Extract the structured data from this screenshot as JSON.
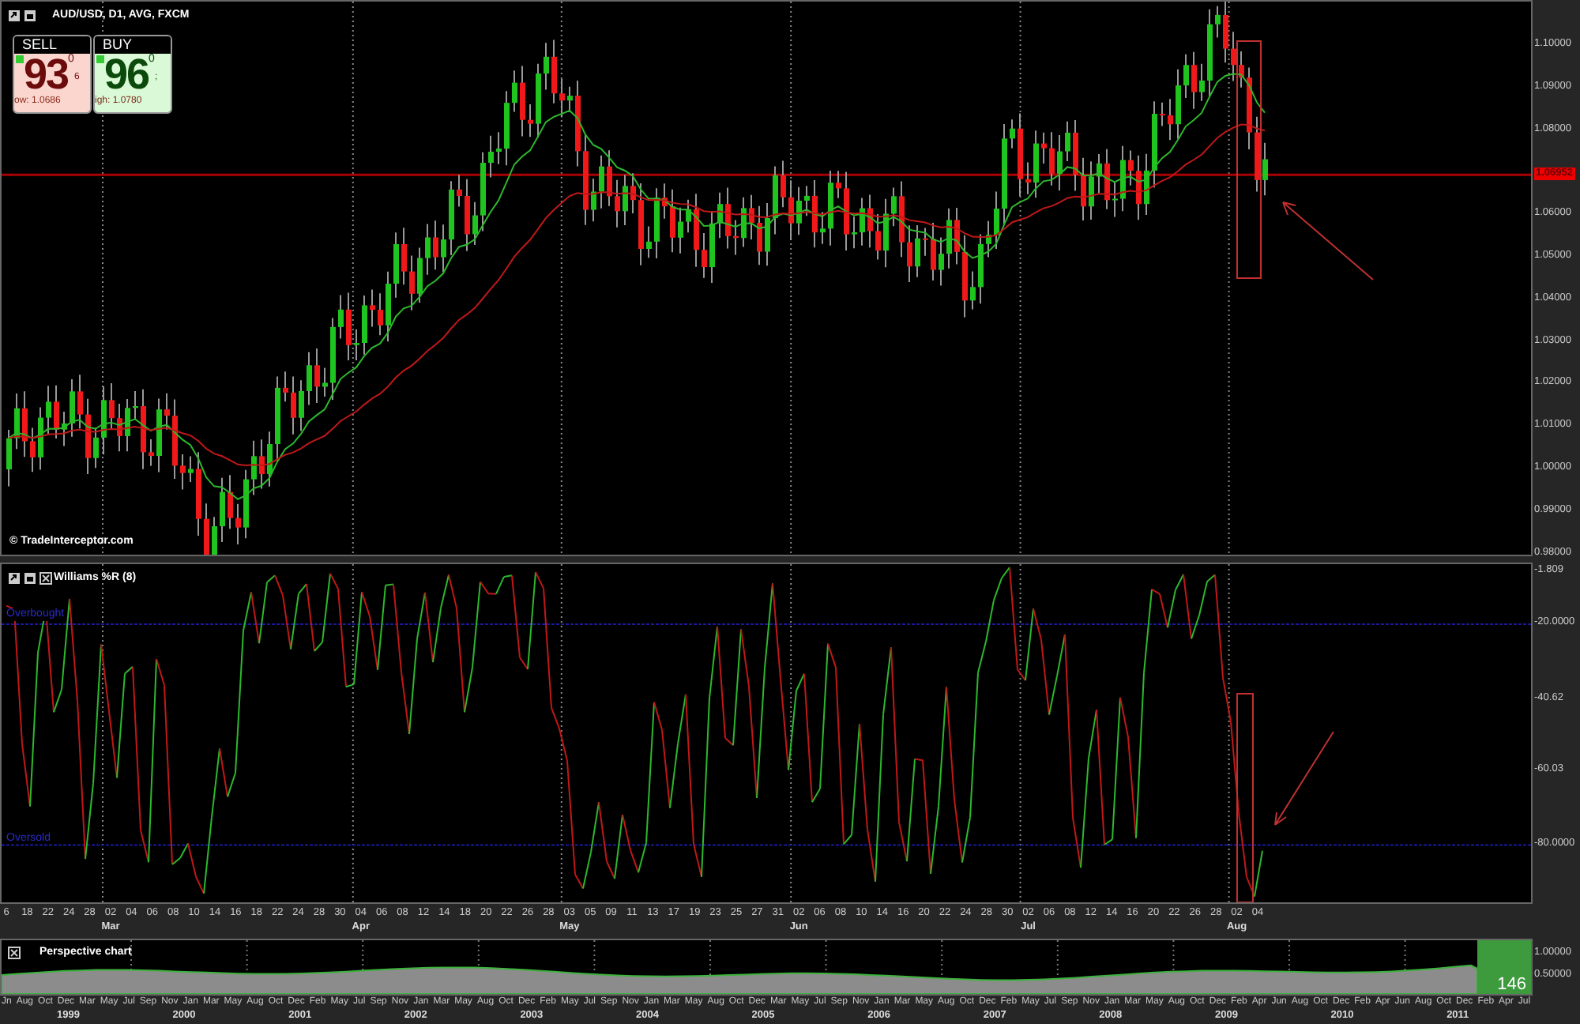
{
  "main_chart": {
    "title": "AUD/USD, D1, AVG, FXCM",
    "quotes": [
      {
        "kind": "sell",
        "label": "SELL",
        "big": "93",
        "pip": "0",
        "tail": "6",
        "range": "ow: 1.0686"
      },
      {
        "kind": "buy",
        "label": "BUY",
        "big": "96",
        "pip": "0",
        "tail": ";",
        "range": "igh: 1.0780"
      }
    ],
    "price_ticks": [
      "1.10000",
      "1.09000",
      "1.08000",
      "1.06000",
      "1.05000",
      "1.04000",
      "1.03000",
      "1.02000",
      "1.01000",
      "1.00000",
      "0.99000",
      "0.98000"
    ],
    "current_price": "1.06952",
    "watermark": "© TradeInterceptor.com"
  },
  "indicator": {
    "title": "Williams %R (8)",
    "overbought_label": "Overbought",
    "oversold_label": "Oversold",
    "ticks": [
      "-1.809",
      "-20.0000",
      "-40.62",
      "-60.03",
      "-80.0000"
    ]
  },
  "date_axis": [
    {
      "label": "6"
    },
    {
      "label": "18"
    },
    {
      "label": "22"
    },
    {
      "label": "24"
    },
    {
      "label": "28"
    },
    {
      "label": "02",
      "month": "Mar"
    },
    {
      "label": "04"
    },
    {
      "label": "06"
    },
    {
      "label": "08"
    },
    {
      "label": "10"
    },
    {
      "label": "14"
    },
    {
      "label": "16"
    },
    {
      "label": "18"
    },
    {
      "label": "22"
    },
    {
      "label": "24"
    },
    {
      "label": "28"
    },
    {
      "label": "30"
    },
    {
      "label": "04",
      "month": "Apr"
    },
    {
      "label": "06"
    },
    {
      "label": "08"
    },
    {
      "label": "12"
    },
    {
      "label": "14"
    },
    {
      "label": "18"
    },
    {
      "label": "20"
    },
    {
      "label": "22"
    },
    {
      "label": "26"
    },
    {
      "label": "28"
    },
    {
      "label": "03",
      "month": "May"
    },
    {
      "label": "05"
    },
    {
      "label": "09"
    },
    {
      "label": "11"
    },
    {
      "label": "13"
    },
    {
      "label": "17"
    },
    {
      "label": "19"
    },
    {
      "label": "23"
    },
    {
      "label": "25"
    },
    {
      "label": "27"
    },
    {
      "label": "31"
    },
    {
      "label": "02",
      "month": "Jun"
    },
    {
      "label": "06"
    },
    {
      "label": "08"
    },
    {
      "label": "10"
    },
    {
      "label": "14"
    },
    {
      "label": "16"
    },
    {
      "label": "20"
    },
    {
      "label": "22"
    },
    {
      "label": "24"
    },
    {
      "label": "28"
    },
    {
      "label": "30"
    },
    {
      "label": "02",
      "month": "Jul"
    },
    {
      "label": "06"
    },
    {
      "label": "08"
    },
    {
      "label": "12"
    },
    {
      "label": "14"
    },
    {
      "label": "16"
    },
    {
      "label": "20"
    },
    {
      "label": "22"
    },
    {
      "label": "26"
    },
    {
      "label": "28"
    },
    {
      "label": "02",
      "month": "Aug"
    },
    {
      "label": "04"
    }
  ],
  "perspective": {
    "title": "Perspective chart",
    "ticks": [
      "1.00000",
      "0.50000"
    ],
    "window_count": "146",
    "months": [
      "Jn",
      "Aug",
      "Oct",
      "Dec",
      "Mar",
      "May",
      "Jul",
      "Sep",
      "Nov",
      "Jan",
      "Mar",
      "May",
      "Aug",
      "Oct",
      "Dec",
      "Feb",
      "May",
      "Jul",
      "Sep",
      "Nov",
      "Jan",
      "Mar",
      "May",
      "Aug",
      "Oct",
      "Dec",
      "Feb",
      "May",
      "Jul",
      "Sep",
      "Nov",
      "Jan",
      "Mar",
      "May",
      "Aug",
      "Oct",
      "Dec",
      "Mar",
      "May",
      "Jul",
      "Sep",
      "Nov",
      "Jan",
      "Mar",
      "May",
      "Aug",
      "Oct",
      "Dec",
      "Feb",
      "May",
      "Jul",
      "Sep",
      "Nov",
      "Jan",
      "Mar",
      "May",
      "Aug",
      "Oct",
      "Dec",
      "Feb",
      "Apr",
      "Jun",
      "Aug",
      "Oct",
      "Dec",
      "Feb",
      "Apr",
      "Jun",
      "Aug",
      "Oct",
      "Dec",
      "Feb",
      "Apr",
      "Jul"
    ],
    "years": [
      "1999",
      "2000",
      "2001",
      "2002",
      "2003",
      "2004",
      "2005",
      "2006",
      "2007",
      "2008",
      "2009",
      "2010",
      "2011"
    ]
  }
}
